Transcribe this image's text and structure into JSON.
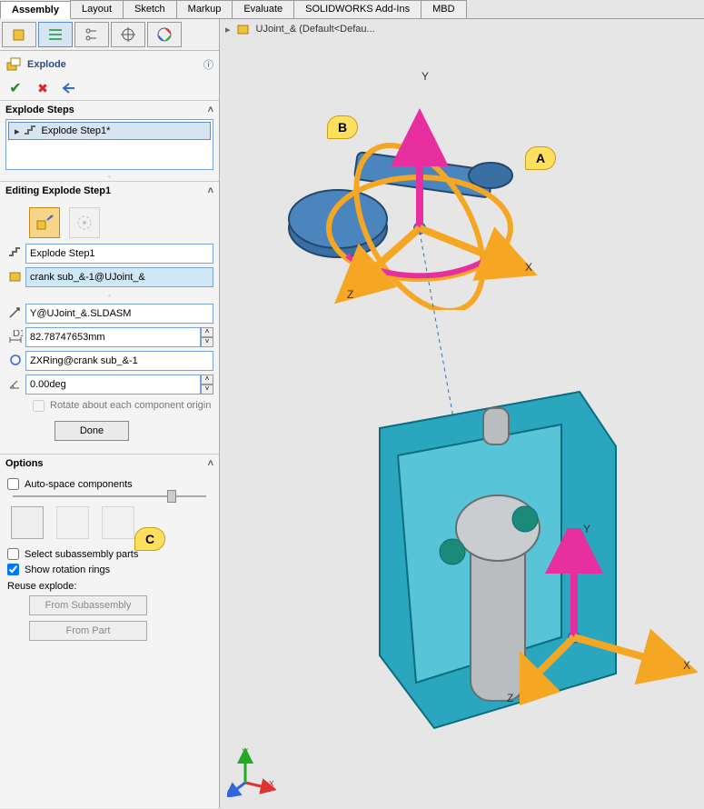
{
  "tabs": [
    "Assembly",
    "Layout",
    "Sketch",
    "Markup",
    "Evaluate",
    "SOLIDWORKS Add-Ins",
    "MBD"
  ],
  "active_tab": 0,
  "crumb": "UJoint_& (Default<Defau...",
  "panel": {
    "title": "Explode",
    "sections": {
      "steps": {
        "label": "Explode Steps",
        "item": "Explode Step1*"
      },
      "editing": {
        "label": "Editing Explode Step1",
        "step_name": "Explode Step1",
        "component": "crank sub_&-1@UJoint_&",
        "direction": "Y@UJoint_&.SLDASM",
        "distance": "82.78747653mm",
        "rot_axis": "ZXRing@crank sub_&-1",
        "angle": "0.00deg",
        "rotate_about_label": "Rotate about each component origin",
        "done_label": "Done"
      },
      "options": {
        "label": "Options",
        "auto_space": "Auto-space components",
        "select_sub": "Select subassembly parts",
        "show_rings": "Show rotation rings",
        "reuse_label": "Reuse explode:",
        "from_sub": "From Subassembly",
        "from_part": "From Part"
      }
    }
  },
  "callouts": {
    "A": "A",
    "B": "B",
    "C": "C"
  },
  "axes": {
    "x": "X",
    "y": "Y",
    "z": "Z"
  }
}
